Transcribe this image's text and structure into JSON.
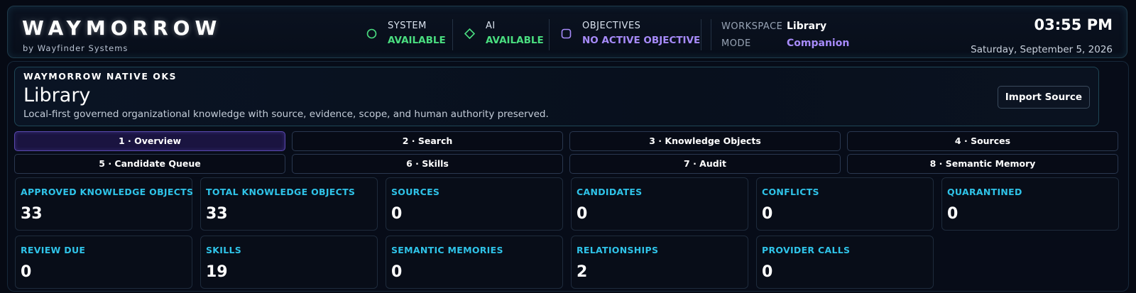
{
  "header": {
    "brand": "WAYMORROW",
    "brand_sub": "by Wayfinder Systems",
    "statuses": [
      {
        "label": "SYSTEM",
        "value": "AVAILABLE",
        "color": "#4ade80",
        "icon": "circle-status-icon"
      },
      {
        "label": "AI",
        "value": "AVAILABLE",
        "color": "#4ade80",
        "icon": "diamond-status-icon"
      },
      {
        "label": "OBJECTIVES",
        "value": "NO ACTIVE OBJECTIVE",
        "color": "#a78bfa",
        "icon": "rounded-square-status-icon"
      }
    ],
    "workspace_label": "WORKSPACE",
    "workspace_value": "Library",
    "mode_label": "MODE",
    "mode_value": "Companion",
    "mode_color": "#a78bfa",
    "time": "03:55 PM",
    "date": "Saturday, September 5, 2026"
  },
  "hero": {
    "eyebrow": "WAYMORROW NATIVE OKS",
    "title": "Library",
    "description": "Local-first governed organizational knowledge with source, evidence, scope, and human authority preserved.",
    "import_button": "Import Source"
  },
  "tabs": [
    {
      "label": "1 · Overview",
      "active": true
    },
    {
      "label": "2 · Search",
      "active": false
    },
    {
      "label": "3 · Knowledge Objects",
      "active": false
    },
    {
      "label": "4 · Sources",
      "active": false
    },
    {
      "label": "5 · Candidate Queue",
      "active": false
    },
    {
      "label": "6 · Skills",
      "active": false
    },
    {
      "label": "7 · Audit",
      "active": false
    },
    {
      "label": "8 · Semantic Memory",
      "active": false
    }
  ],
  "stats": [
    {
      "label": "APPROVED KNOWLEDGE OBJECTS",
      "value": "33"
    },
    {
      "label": "TOTAL KNOWLEDGE OBJECTS",
      "value": "33"
    },
    {
      "label": "SOURCES",
      "value": "0"
    },
    {
      "label": "CANDIDATES",
      "value": "0"
    },
    {
      "label": "CONFLICTS",
      "value": "0"
    },
    {
      "label": "QUARANTINED",
      "value": "0"
    },
    {
      "label": "REVIEW DUE",
      "value": "0"
    },
    {
      "label": "SKILLS",
      "value": "19"
    },
    {
      "label": "SEMANTIC MEMORIES",
      "value": "0"
    },
    {
      "label": "RELATIONSHIPS",
      "value": "2"
    },
    {
      "label": "PROVIDER CALLS",
      "value": "0"
    }
  ],
  "colors": {
    "accent_cyan": "#2fc3e8",
    "available_green": "#4ade80",
    "objective_purple": "#a78bfa"
  }
}
